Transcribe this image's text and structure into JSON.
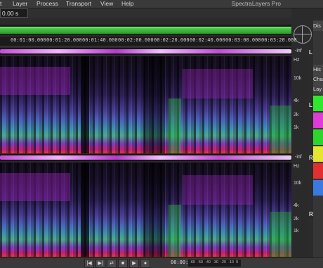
{
  "menu": {
    "items": [
      "t",
      "Layer",
      "Process",
      "Transport",
      "View",
      "Help"
    ],
    "app_title": "SpectraLayers Pro"
  },
  "time_field": "0.00 s",
  "ruler": {
    "ticks": [
      "00:01:00.000",
      "00:01:20.000",
      "00:01:40.000",
      "00:02:00.000",
      "00:02:20.000",
      "00:02:40.000",
      "00:03:00.000",
      "00:03:20.000"
    ]
  },
  "level": {
    "top": "-inf",
    "bottom": "-inf"
  },
  "channels": {
    "left": "L",
    "right": "R"
  },
  "freq_axis": {
    "unit": "Hz",
    "labels": [
      "10k",
      "4k",
      "2k",
      "1k"
    ]
  },
  "side_tabs": [
    "Dis",
    "His",
    "Cha",
    "Lay"
  ],
  "layer_colors": [
    "#2ee82e",
    "#e03ad8",
    "#2ed42e",
    "#e6e630",
    "#e23030",
    "#3a7ae0"
  ],
  "transport": {
    "timecode": "00:00:00.000",
    "meter_labels": [
      "-60",
      "-50",
      "-40",
      "-30",
      "-20",
      "-10",
      "0"
    ],
    "buttons": [
      "|◀",
      "▶|",
      "⇄",
      "■",
      "▶",
      "●"
    ]
  }
}
